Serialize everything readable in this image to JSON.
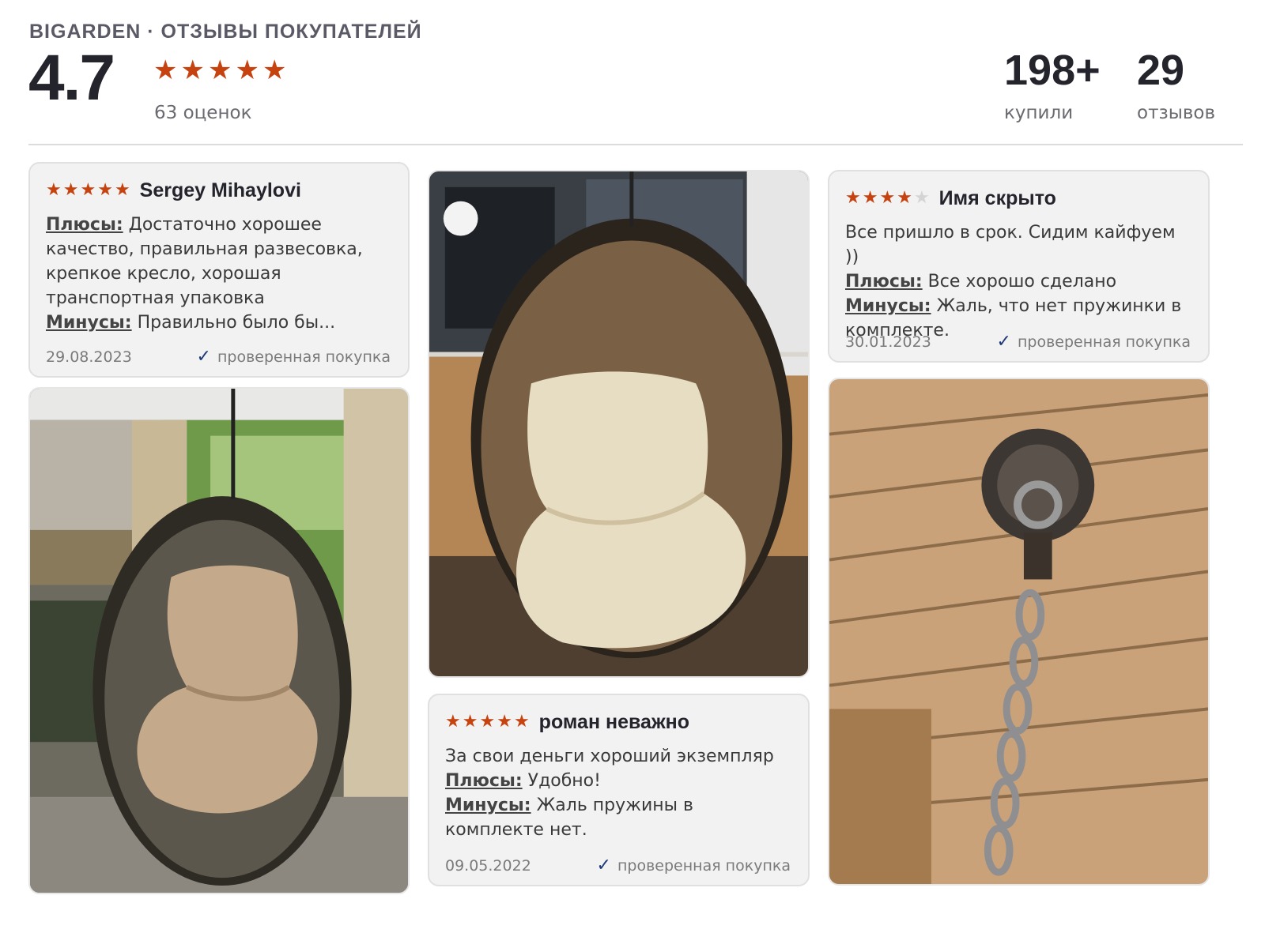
{
  "header": {
    "kicker": "BIGARDEN · ОТЗЫВЫ ПОКУПАТЕЛЕЙ",
    "rating": "4.7",
    "stars": [
      "★",
      "★",
      "★",
      "★",
      "★"
    ],
    "ratings_count": "63 оценок",
    "bought_value": "198+",
    "bought_label": "купили",
    "reviews_value": "29",
    "reviews_label": "отзывов"
  },
  "reviews": [
    {
      "author": "Sergey Mihaylovi",
      "stars": [
        "★",
        "★",
        "★",
        "★",
        "★"
      ],
      "pros_label": "Плюсы:",
      "pros": "Достаточно хорошее качество, правильная развесовка, крепкое кресло, хорошая транспортная упаковка",
      "cons_label": "Минусы:",
      "cons": "Правильно было бы...",
      "date": "29.08.2023",
      "verified": "проверенная покупка"
    },
    {
      "author": "Имя скрыто",
      "stars": [
        "★",
        "★",
        "★",
        "★",
        "★"
      ],
      "text": "Все пришло в срок. Сидим кайфуем ))",
      "pros_label": "Плюсы:",
      "pros": "Все хорошо сделано",
      "cons_label": "Минусы:",
      "cons": "Жаль, что нет пружинки в комплекте.",
      "date": "30.01.2023",
      "verified": "проверенная покупка"
    },
    {
      "author": "роман неважно",
      "stars": [
        "★",
        "★",
        "★",
        "★",
        "★"
      ],
      "text": "За свои деньги хороший экземпляр",
      "pros_label": "Плюсы:",
      "pros": "Удобно!",
      "cons_label": "Минусы:",
      "cons": "Жаль пружины в комплекте нет.",
      "date": "09.05.2022",
      "verified": "проверенная покупка"
    }
  ],
  "ratings": {
    "review_1": 5,
    "review_2": 4,
    "review_3": 5
  },
  "icons": {
    "check": "check-icon",
    "star": "star-icon"
  },
  "colors": {
    "star": "#c6420f",
    "check": "#1f3a78",
    "card_bg": "#f2f2f2"
  }
}
